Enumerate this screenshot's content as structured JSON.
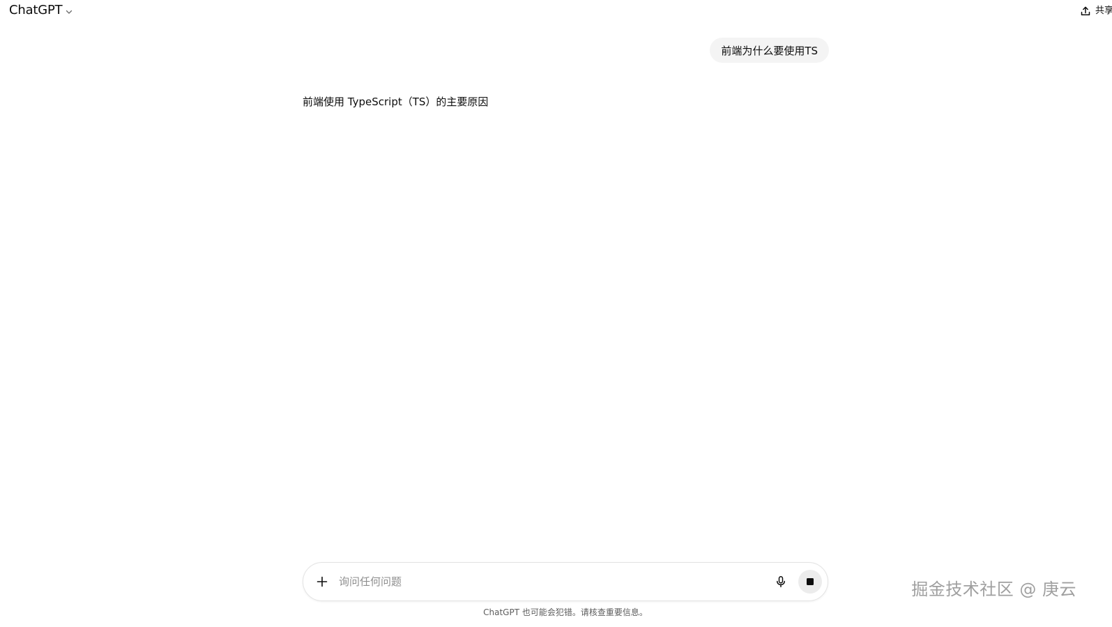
{
  "header": {
    "model_name": "ChatGPT",
    "share_label": "共享"
  },
  "conversation": {
    "user_message": "前端为什么要使用TS",
    "assistant_message": "前端使用 TypeScript（TS）的主要原因"
  },
  "composer": {
    "placeholder": "询问任何问题",
    "value": ""
  },
  "footer": {
    "disclaimer": "ChatGPT 也可能会犯错。请核查重要信息。"
  },
  "watermark": {
    "text": "掘金技术社区 @ 庚云"
  },
  "icons": {
    "model_chevron": "chevron-down-icon",
    "share": "share-upload-icon",
    "add": "plus-icon",
    "voice": "microphone-icon",
    "stop": "stop-icon"
  }
}
